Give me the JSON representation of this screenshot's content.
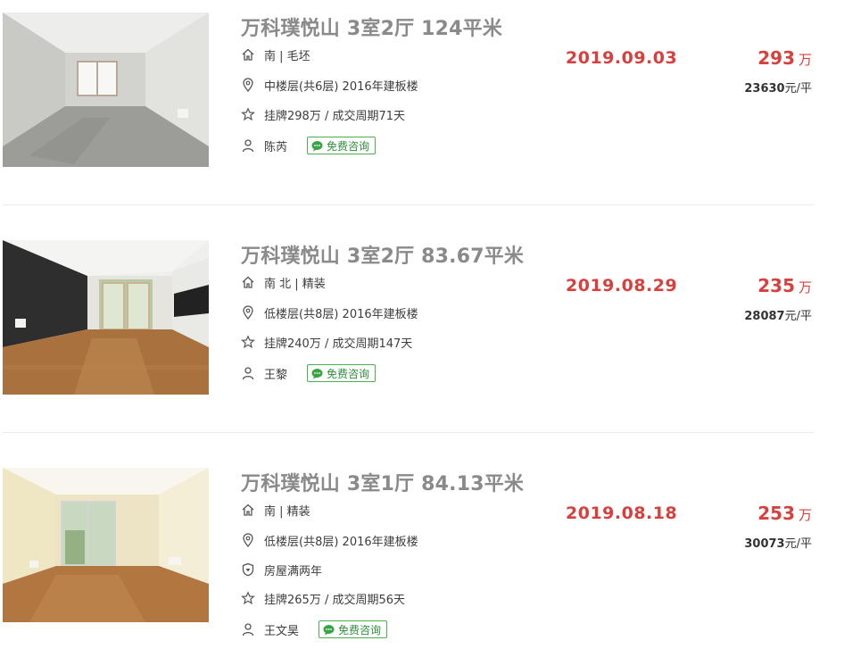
{
  "listings": [
    {
      "title": "万科璞悦山 3室2厅 124平米",
      "orientation": "南 | 毛坯",
      "floor": "中楼层(共6层) 2016年建板楼",
      "extra_tag": "",
      "listing": "挂牌298万 / 成交周期71天",
      "agent": "陈芮",
      "consult_label": "免费咨询",
      "date": "2019.09.03",
      "total_price": "293",
      "price_unit": "万",
      "unit_price_value": "23630",
      "unit_price_suffix": "元/平",
      "photo_style": "unfinished"
    },
    {
      "title": "万科璞悦山 3室2厅 83.67平米",
      "orientation": "南 北 | 精装",
      "floor": "低楼层(共8层) 2016年建板楼",
      "extra_tag": "",
      "listing": "挂牌240万 / 成交周期147天",
      "agent": "王黎",
      "consult_label": "免费咨询",
      "date": "2019.08.29",
      "total_price": "235",
      "price_unit": "万",
      "unit_price_value": "28087",
      "unit_price_suffix": "元/平",
      "photo_style": "dark-wall"
    },
    {
      "title": "万科璞悦山 3室1厅 84.13平米",
      "orientation": "南 | 精装",
      "floor": "低楼层(共8层) 2016年建板楼",
      "extra_tag": "房屋满两年",
      "listing": "挂牌265万 / 成交周期56天",
      "agent": "王文昊",
      "consult_label": "免费咨询",
      "date": "2019.08.18",
      "total_price": "253",
      "price_unit": "万",
      "unit_price_value": "30073",
      "unit_price_suffix": "元/平",
      "photo_style": "cream-wall"
    }
  ],
  "icons": {
    "orientation": "house-icon",
    "floor": "location-pin-icon",
    "extra_tag": "shield-icon",
    "listing": "star-icon",
    "agent": "person-icon",
    "consult": "chat-bubble-icon"
  },
  "colors": {
    "price_red": "#d9403d",
    "title_gray": "#8a8a8a",
    "consult_green": "#4caf50"
  }
}
